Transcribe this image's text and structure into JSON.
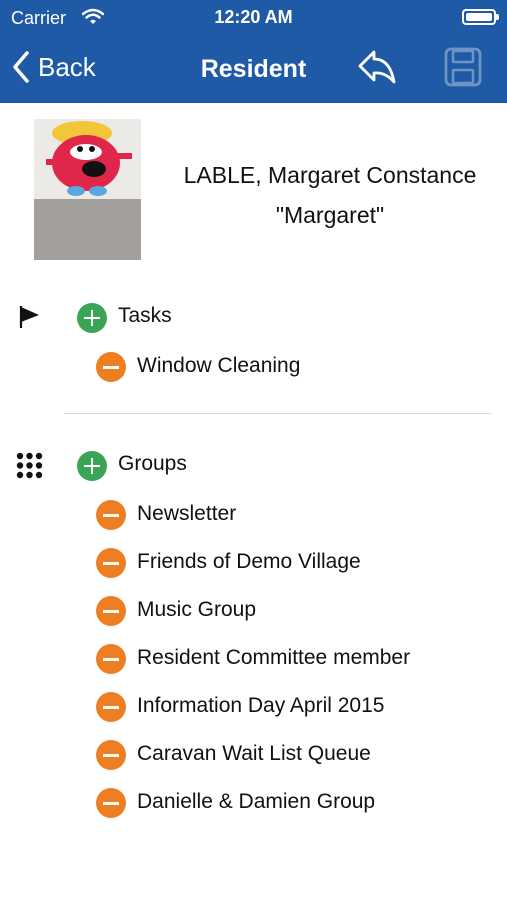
{
  "status_bar": {
    "carrier": "Carrier",
    "time": "12:20 AM"
  },
  "nav": {
    "back_label": "Back",
    "title": "Resident"
  },
  "resident": {
    "name": "LABLE, Margaret Constance",
    "nickname": "\"Margaret\""
  },
  "tasks": {
    "header": "Tasks",
    "items": [
      "Window Cleaning"
    ]
  },
  "groups": {
    "header": "Groups",
    "items": [
      "Newsletter",
      "Friends of Demo Village",
      "Music Group",
      "Resident Committee member",
      "Information Day April 2015",
      "Caravan Wait List Queue",
      "Danielle & Damien Group"
    ]
  },
  "colors": {
    "nav_blue": "#1f5aa6",
    "add_green": "#3aa655",
    "remove_orange": "#ee7e22"
  },
  "icons": {
    "tasks": "flag-icon",
    "groups": "grid-dots-icon",
    "reply": "reply-icon",
    "save": "save-icon"
  }
}
